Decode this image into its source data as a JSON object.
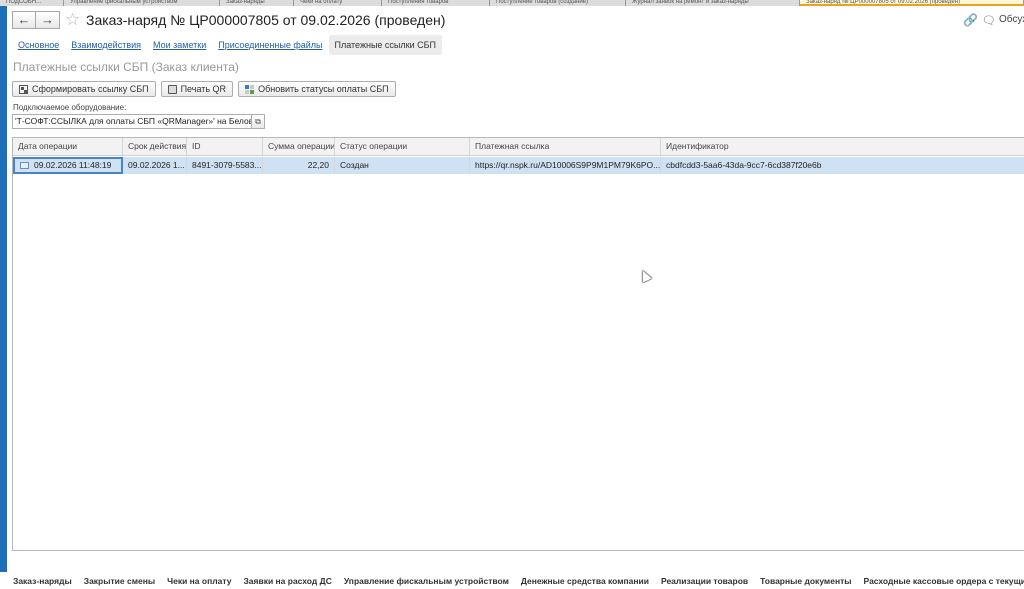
{
  "top_tabs": [
    "ПОДСОБН...",
    "Управление фискальным устройством",
    "Заказ-наряды",
    "Чеки на оплату",
    "Поступления товаров",
    "Поступление товаров (создание)",
    "Журнал заявок на ремонт и заказ-наряды",
    "Заказ-наряд № ЦР000007805 от 09.02.2026 (проведен)"
  ],
  "header": {
    "back_icon": "arrow-left-icon",
    "forward_icon": "arrow-right-icon",
    "back_glyph": "←",
    "forward_glyph": "→",
    "favorite_glyph": "☆",
    "title": "Заказ-наряд № ЦР000007805 от 09.02.2026 (проведен)",
    "link_glyph": "🔗",
    "discuss_glyph": "🗨",
    "discuss_label": "Обсуж"
  },
  "tabs": [
    {
      "label": "Основное"
    },
    {
      "label": "Взаимодействия"
    },
    {
      "label": "Мои заметки"
    },
    {
      "label": "Присоединенные файлы"
    },
    {
      "label": "Платежные ссылки СБП"
    }
  ],
  "form_title": "Платежные ссылки СБП (Заказ клиента)",
  "toolbar": {
    "generate_label": "Сформировать ссылку СБП",
    "print_label": "Печать QR",
    "refresh_label": "Обновить статусы оплаты СБП"
  },
  "equipment": {
    "label": "Подключаемое оборудование:",
    "value": "'Т-СОФТ:ССЫЛКА для оплаты СБП «QRManager»' на БеловаМЕ",
    "button_glyph": "⧉"
  },
  "table": {
    "columns": [
      "Дата операции",
      "Срок действия",
      "ID",
      "Сумма операции",
      "Статус операции",
      "Платежная ссылка",
      "Идентификатор"
    ],
    "rows": [
      [
        "09.02.2026 11:48:19",
        "09.02.2026 1...",
        "8491-3079-5583...",
        "22,20",
        "Создан",
        "https://qr.nspk.ru/AD10006S9P9M1PM79K6PO...",
        "cbdfcdd3-5aa6-43da-9cc7-6cd387f20e6b"
      ]
    ]
  },
  "bottom_bar": [
    "Заказ-наряды",
    "Закрытие смены",
    "Чеки на оплату",
    "Заявки на расход ДС",
    "Управление фискальным устройством",
    "Денежные средства компании",
    "Реализации товаров",
    "Товарные документы",
    "Расходные кассовые ордера с текущими"
  ],
  "colors": {
    "accent": "#1d6fb8",
    "selected_row": "#cfe2f3",
    "link": "#1f5fa8"
  }
}
